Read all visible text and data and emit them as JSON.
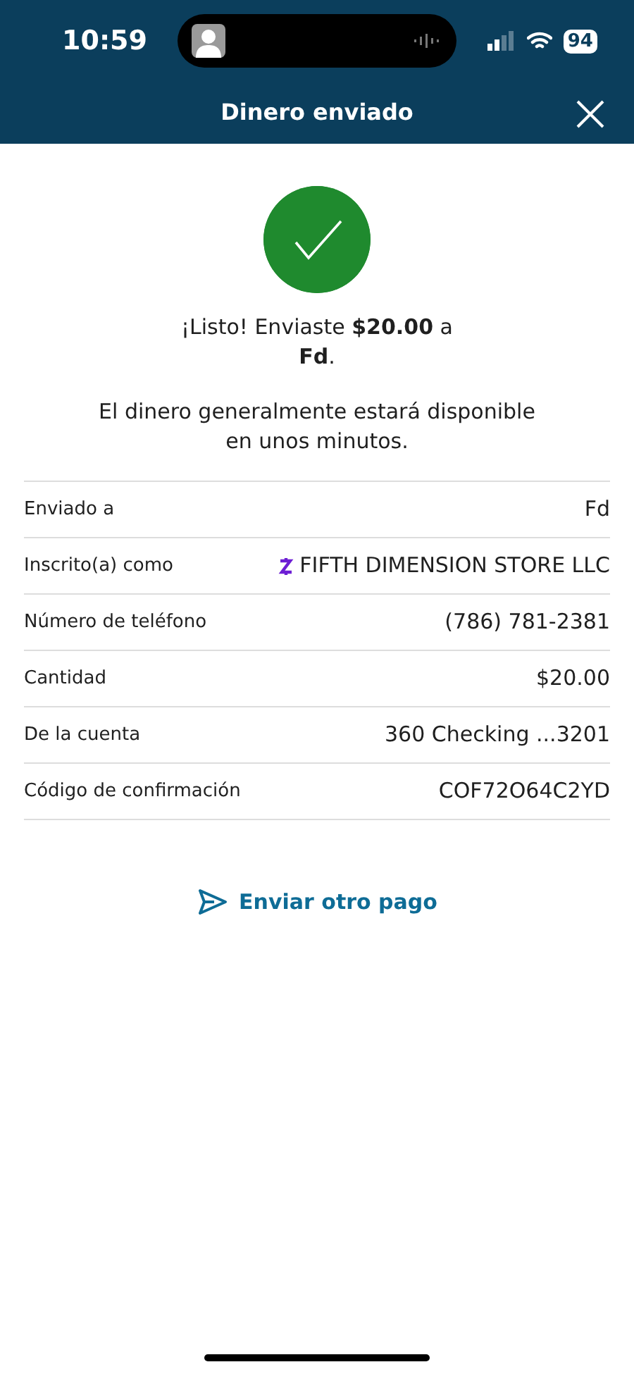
{
  "status_bar": {
    "time": "10:59",
    "battery": "94"
  },
  "header": {
    "title": "Dinero enviado"
  },
  "confirmation": {
    "message": "¡Listo! Enviaste **$20.00** a **Fd**.",
    "note": "El dinero generalmente estará disponible en unos minutos."
  },
  "details": [
    {
      "kind": "plain",
      "label": "Enviado a",
      "value": "Fd"
    },
    {
      "kind": "zelle",
      "label": "Inscrito(a) como",
      "value": "FIFTH DIMENSION STORE LLC"
    },
    {
      "kind": "plain",
      "label": "Número de teléfono",
      "value": "(786) 781-2381"
    },
    {
      "kind": "plain",
      "label": "Cantidad",
      "value": "$20.00"
    },
    {
      "kind": "plain",
      "label": "De la cuenta",
      "value": "360 Checking ...3201"
    },
    {
      "kind": "plain",
      "label": "Código de confirmación",
      "value": "COF72O64C2YD"
    }
  ],
  "action": {
    "label": "Enviar otro pago"
  }
}
